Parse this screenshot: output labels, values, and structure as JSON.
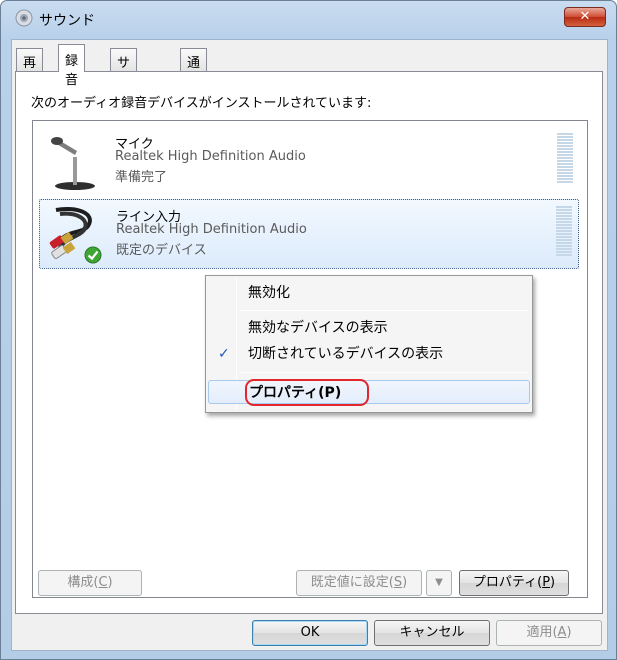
{
  "window": {
    "title": "サウンド",
    "close_label": "✕",
    "icon": "speaker-icon"
  },
  "tabs": [
    {
      "label": "再生",
      "active": false
    },
    {
      "label": "録音",
      "active": true
    },
    {
      "label": "サウンド",
      "active": false
    },
    {
      "label": "通信",
      "active": false
    }
  ],
  "panel": {
    "intro": "次のオーディオ録音デバイスがインストールされています:"
  },
  "devices": [
    {
      "name": "マイク",
      "driver": "Realtek High Definition Audio",
      "status": "準備完了",
      "icon": "microphone-icon",
      "selected": false
    },
    {
      "name": "ライン入力",
      "driver": "Realtek High Definition Audio",
      "status": "既定のデバイス",
      "icon": "line-in-cable-icon",
      "selected": true,
      "default_badge": "check-icon"
    }
  ],
  "context_menu": {
    "items": [
      {
        "label": "無効化"
      },
      {
        "label": "無効なデバイスの表示"
      },
      {
        "label": "切断されているデバイスの表示",
        "checked": true
      },
      {
        "label": "プロパティ(P)",
        "hover": true,
        "highlighted": true
      }
    ]
  },
  "panel_buttons": {
    "configure": {
      "label": "構成(",
      "key": "C",
      "tail": ")"
    },
    "set_default": {
      "label": "既定値に設定(",
      "key": "S",
      "tail": ")"
    },
    "set_default_arrow": "▼",
    "properties": {
      "label": "プロパティ(",
      "key": "P",
      "tail": ")"
    }
  },
  "dialog_buttons": {
    "ok": "OK",
    "cancel": "キャンセル",
    "apply": {
      "label": "適用(",
      "key": "A",
      "tail": ")"
    }
  },
  "colors": {
    "highlight_ring": "#e2262b",
    "selection": "#dcebfc",
    "check": "#1f55c4"
  }
}
